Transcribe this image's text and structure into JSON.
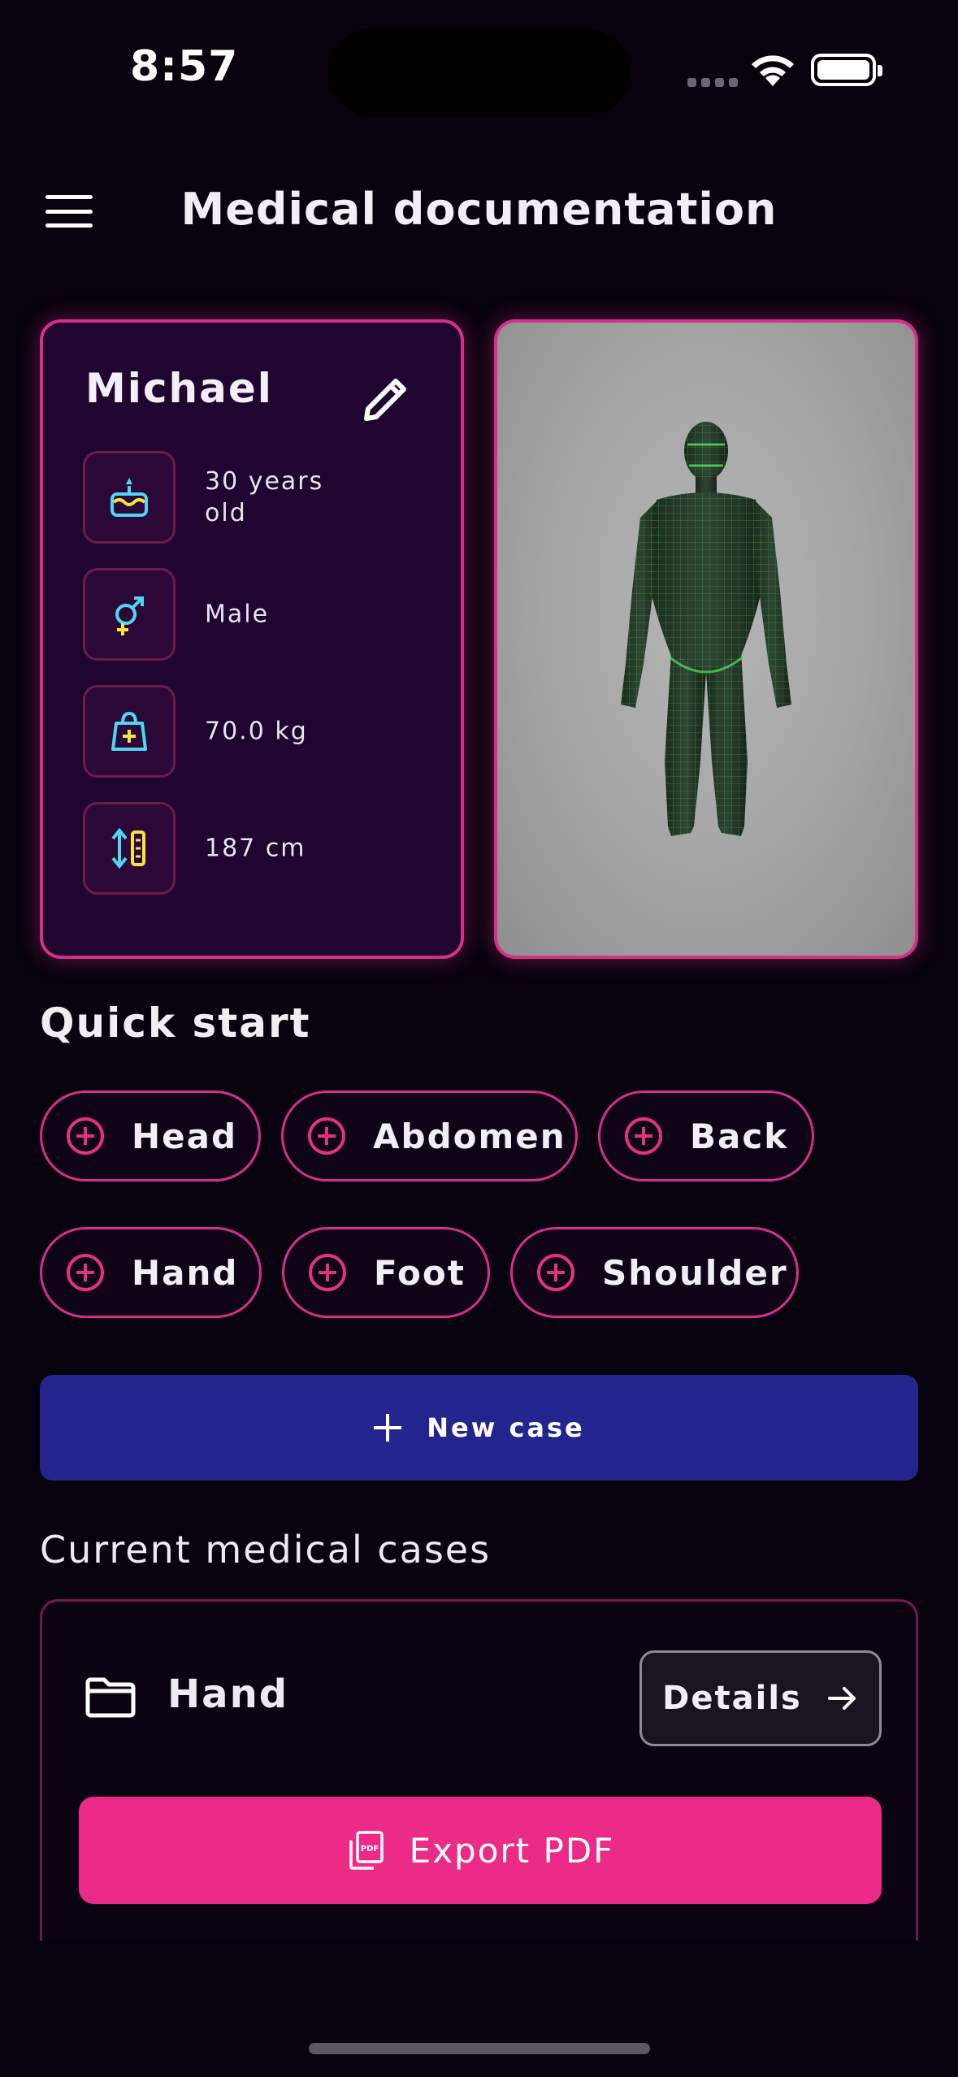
{
  "status_bar": {
    "time": "8:57"
  },
  "header": {
    "title": "Medical documentation"
  },
  "patient": {
    "name": "Michael",
    "age": "30 years old",
    "sex": "Male",
    "weight": "70.0 kg",
    "height": "187 cm"
  },
  "quick_start": {
    "title": "Quick start",
    "chips": [
      "Head",
      "Abdomen",
      "Back",
      "Hand",
      "Foot",
      "Shoulder"
    ]
  },
  "new_case": {
    "label": "New case"
  },
  "cases": {
    "title": "Current medical cases",
    "items": [
      {
        "name": "Hand",
        "details_label": "Details",
        "export_label": "Export PDF"
      }
    ]
  },
  "colors": {
    "accent_pink": "#ec2a88",
    "primary_blue": "#23248e",
    "card_background": "#1f0530",
    "icon_cyan": "#4fd6f0",
    "icon_yellow": "#f5e53a"
  },
  "icons": {
    "menu": "hamburger-icon",
    "edit": "pencil-icon",
    "age": "birthday-cake-icon",
    "sex": "gender-icon",
    "weight": "weight-bag-icon",
    "height": "ruler-height-icon",
    "chip": "add-circle-icon",
    "folder": "folder-icon",
    "arrow": "arrow-right-icon",
    "pdf": "pdf-file-icon"
  }
}
